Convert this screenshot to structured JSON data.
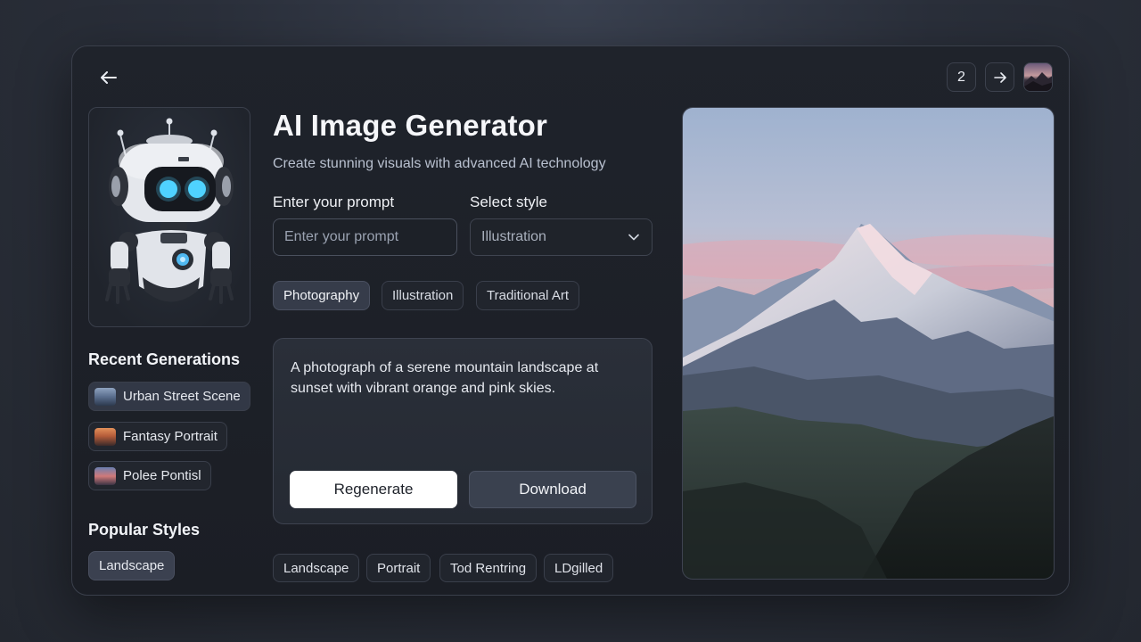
{
  "header": {
    "back_icon": "arrow-left-icon",
    "page_number": "2",
    "next_icon": "arrow-right-icon"
  },
  "main": {
    "title": "AI Image Generator",
    "subtitle": "Create stunning visuals with advanced AI technology",
    "prompt_label": "Enter your prompt",
    "prompt_placeholder": "Enter your prompt",
    "style_label": "Select style",
    "style_selected": "Illustration",
    "tabs": [
      {
        "label": "Photography",
        "active": true
      },
      {
        "label": "Illustration",
        "active": false
      },
      {
        "label": "Traditional Art",
        "active": false
      }
    ],
    "description": "A photograph of a serene mountain landscape at sunset with vibrant orange and pink skies.",
    "regenerate_label": "Regenerate",
    "download_label": "Download",
    "bottom_chips": [
      "Landscape",
      "Portrait",
      "Tod Rentring",
      "LDgilled"
    ]
  },
  "sidebar": {
    "recent_title": "Recent Generations",
    "recent_items": [
      {
        "label": "Urban Street Scene",
        "active": true
      },
      {
        "label": "Fantasy Portrait",
        "active": false
      },
      {
        "label": "Polee Pontisl",
        "active": false
      }
    ],
    "styles_title": "Popular Styles",
    "styles": [
      "Landscape"
    ]
  },
  "colors": {
    "accent_eye": "#4fd2ff",
    "primary_button": "#ffffff",
    "secondary_button": "#3a414f"
  }
}
